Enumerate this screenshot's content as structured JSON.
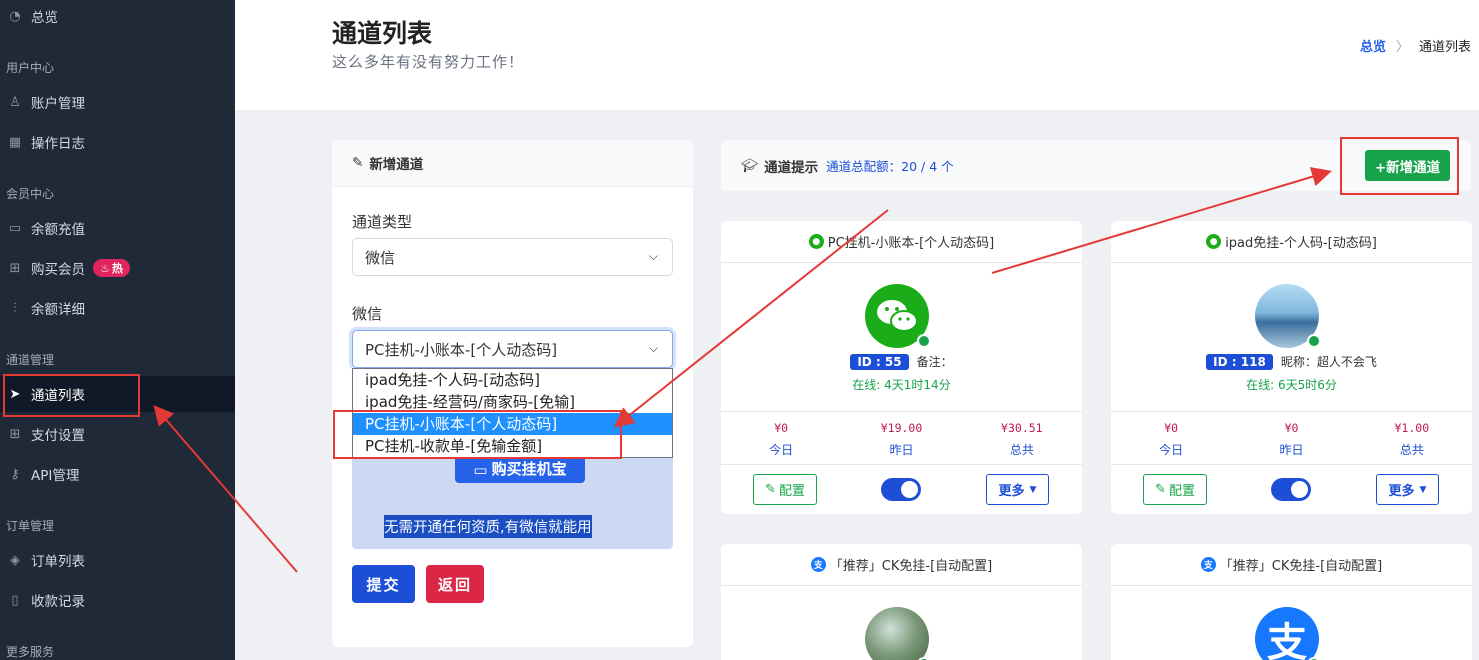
{
  "sidebar": {
    "dashboard": "总览",
    "groups": {
      "user_center": "用户中心",
      "member_center": "会员中心",
      "channel_mgmt": "通道管理",
      "order_mgmt": "订单管理",
      "more_services": "更多服务"
    },
    "items": {
      "account": "账户管理",
      "oplog": "操作日志",
      "recharge": "余额充值",
      "buy_member": "购买会员",
      "hot": "热",
      "balance_detail": "余额详细",
      "channel_list": "通道列表",
      "payment_settings": "支付设置",
      "api": "API管理",
      "order_list": "订单列表",
      "receipts": "收款记录"
    }
  },
  "header": {
    "title": "通道列表",
    "subtitle": "这么多年有没有努力工作！",
    "breadcrumb": {
      "home": "总览",
      "current": "通道列表"
    }
  },
  "form": {
    "card_title": "新增通道",
    "type_label": "通道类型",
    "type_value": "微信",
    "sub_label": "微信",
    "sub_value": "PC挂机-小账本-[个人动态码]",
    "options": [
      "ipad免挂-个人码-[动态码]",
      "ipad免挂-经营码/商家码-[免输]",
      "PC挂机-小账本-[个人动态码]",
      "PC挂机-收款单-[免输金额]"
    ],
    "selected_index": 2,
    "buy_button": "购买挂机宝",
    "info_text": "无需开通任何资质,有微信就能用",
    "submit": "提交",
    "back": "返回"
  },
  "tips": {
    "title": "通道提示",
    "quota": "通道总配额：20 / 4 个",
    "add_button": "+新增通道"
  },
  "cards": [
    {
      "title": "PC挂机-小账本-[个人动态码]",
      "id": "ID : 55",
      "extra": "备注：",
      "online": "在线: 4天1时14分",
      "stats": [
        {
          "value": "¥0",
          "label": "今日"
        },
        {
          "value": "¥19.00",
          "label": "昨日"
        },
        {
          "value": "¥30.51",
          "label": "总共"
        }
      ],
      "config": "配置",
      "more": "更多"
    },
    {
      "title": "ipad免挂-个人码-[动态码]",
      "id": "ID : 118",
      "extra": "昵称：超人不会飞",
      "online": "在线: 6天5时6分",
      "stats": [
        {
          "value": "¥0",
          "label": "今日"
        },
        {
          "value": "¥0",
          "label": "昨日"
        },
        {
          "value": "¥1.00",
          "label": "总共"
        }
      ],
      "config": "配置",
      "more": "更多"
    },
    {
      "title": "「推荐」CK免挂-[自动配置]"
    },
    {
      "title": "「推荐」CK免挂-[自动配置]"
    }
  ],
  "colors": {
    "sidebar": "#1f2937",
    "primary": "#1d4ed8",
    "success": "#16a34a",
    "danger": "#dc2645",
    "annotation": "#e53935"
  }
}
